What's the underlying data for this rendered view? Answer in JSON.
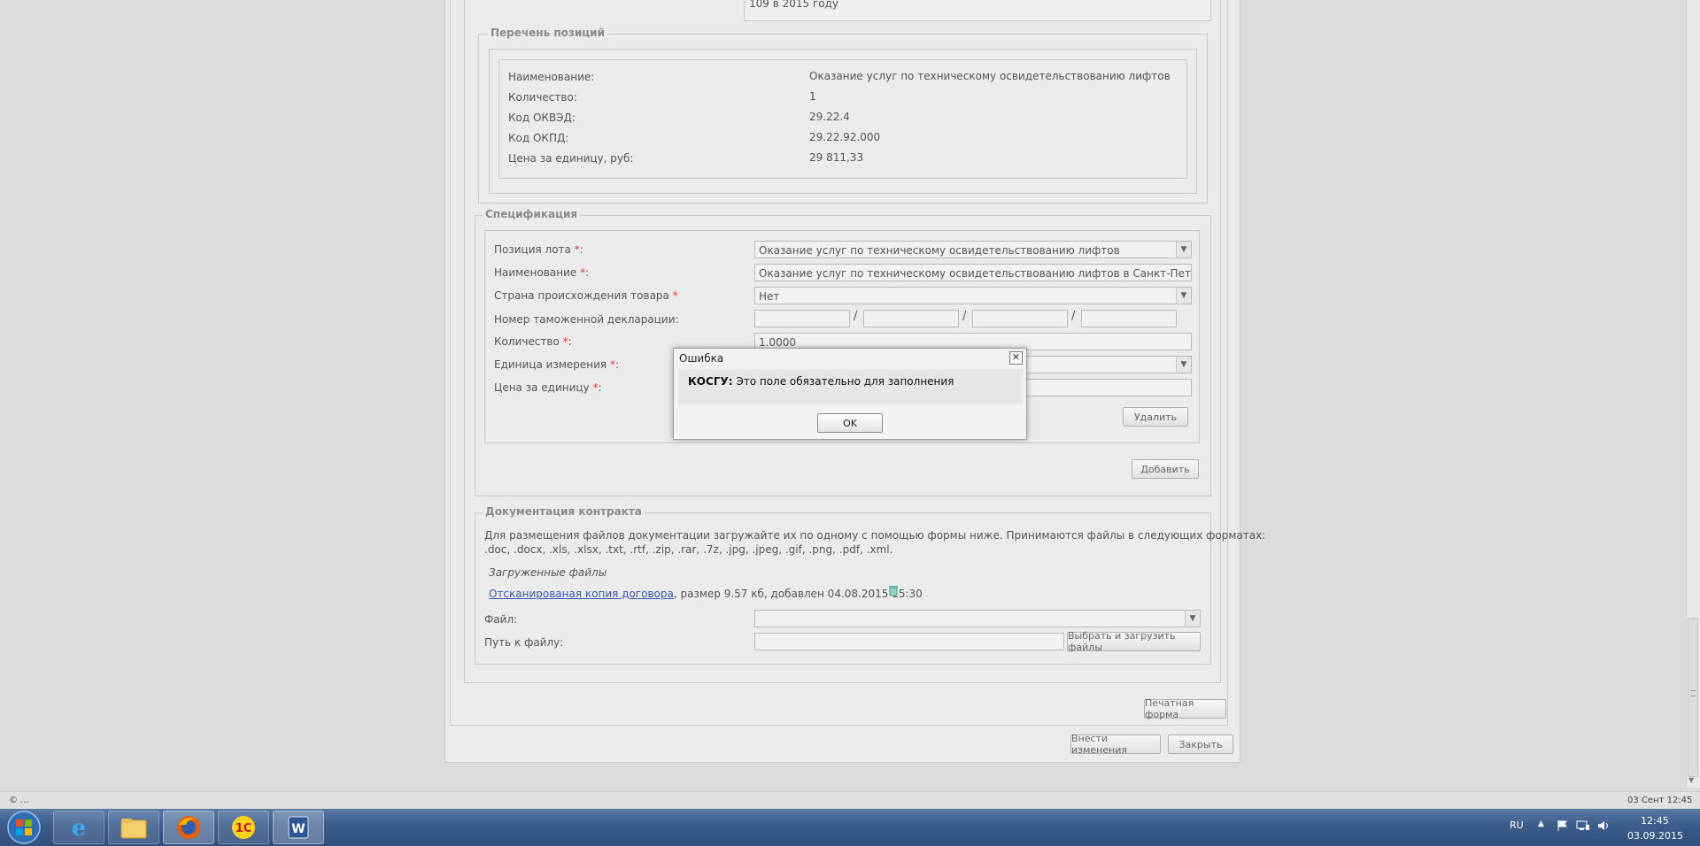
{
  "top_field": {
    "text": "109  в 2015 году"
  },
  "positions": {
    "legend": "Перечень позиций",
    "rows": [
      {
        "label": "Наименование:",
        "value": "Оказание услуг по техническому освидетельствованию лифтов"
      },
      {
        "label": "Количество:",
        "value": "1"
      },
      {
        "label": "Код ОКВЭД:",
        "value": "29.22.4"
      },
      {
        "label": "Код ОКПД:",
        "value": "29.22.92.000"
      },
      {
        "label": "Цена за единицу, руб:",
        "value": "29 811,33"
      }
    ]
  },
  "spec": {
    "legend": "Спецификация",
    "lot_position": {
      "label": "Позиция лота",
      "value": "Оказание услуг по техническому освидетельствованию лифтов"
    },
    "name": {
      "label": "Наименование",
      "value": "Оказание услуг по техническому освидетельствованию лифтов в Санкт-Петербурге"
    },
    "country": {
      "label": "Страна происхождения товара",
      "value": "Нет"
    },
    "customs": {
      "label": "Номер таможенной декларации:"
    },
    "quantity": {
      "label": "Количество",
      "value": "1.0000"
    },
    "unit": {
      "label": "Единица измерения"
    },
    "price": {
      "label": "Цена за единицу"
    },
    "required_mark": "*",
    "colon": ":",
    "delete_label": "Удалить",
    "add_label": "Добавить"
  },
  "docs": {
    "legend": "Документация контракта",
    "info_line1": "Для размещения файлов документации загружайте их по одному с помощью формы ниже. Принимаются файлы в следующих форматах:",
    "info_line2": ".doc, .docx, .xls, .xlsx, .txt, .rtf, .zip, .rar, .7z, .jpg, .jpeg, .gif, .png, .pdf, .xml.",
    "uploaded_title": "Загруженные файлы",
    "file_link": "Отсканированая копия договора",
    "file_meta": ", размер 9.57 кб, добавлен 04.08.2015 15:30",
    "file_label": "Файл:",
    "path_label": "Путь к файлу:",
    "upload_label": "Выбрать и загрузить файлы"
  },
  "buttons": {
    "print": "Печатная форма",
    "save": "Внести изменения",
    "close": "Закрыть"
  },
  "status": {
    "left": "© ...",
    "right": "03 Сент 12:45"
  },
  "dialog": {
    "title": "Ошибка",
    "field": "КОСГУ:",
    "message": " Это поле обязательно для заполнения",
    "ok": "OK",
    "close_glyph": "✕"
  },
  "taskbar": {
    "lang": "RU",
    "time": "12:45",
    "date": "03.09.2015",
    "onec_label": "1С",
    "word_label": "W"
  }
}
